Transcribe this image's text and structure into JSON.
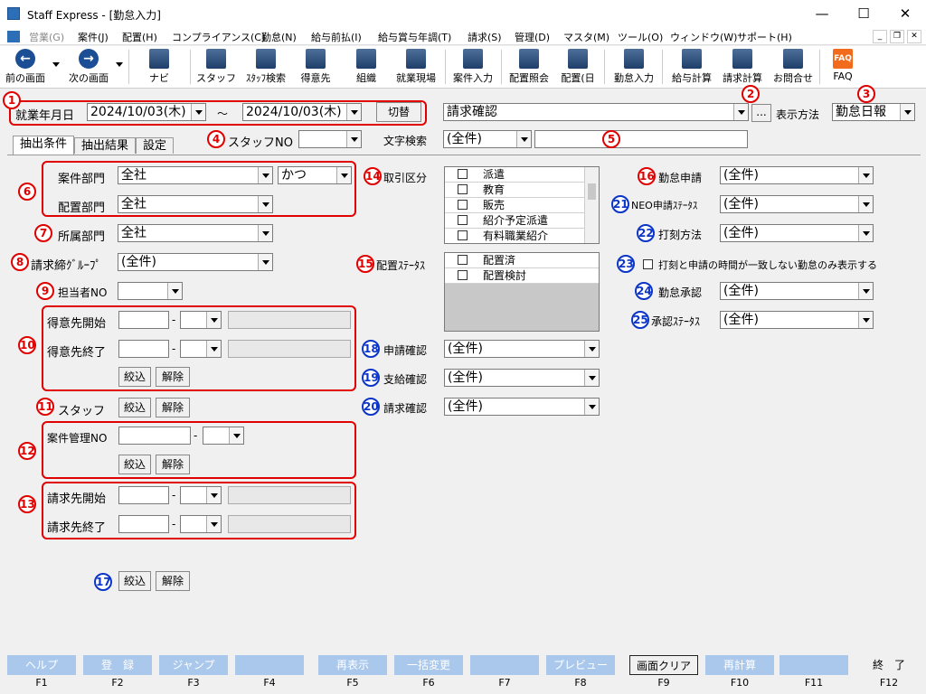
{
  "window": {
    "title": "Staff Express - [勤怠入力]",
    "minimize": "—",
    "maximize": "☐",
    "close": "✕"
  },
  "menu": [
    {
      "label": "営業(G)",
      "enabled": false
    },
    {
      "label": "案件(J)",
      "enabled": true
    },
    {
      "label": "配置(H)",
      "enabled": true
    },
    {
      "label": "コンプライアンス(C)",
      "enabled": true
    },
    {
      "label": "勤怠(N)",
      "enabled": true
    },
    {
      "label": "給与前払(I)",
      "enabled": true
    },
    {
      "label": "給与賞与年調(T)",
      "enabled": true
    },
    {
      "label": "請求(S)",
      "enabled": true
    },
    {
      "label": "管理(D)",
      "enabled": true
    },
    {
      "label": "マスタ(M)",
      "enabled": true
    },
    {
      "label": "ツール(O)",
      "enabled": true
    },
    {
      "label": "ウィンドウ(W)",
      "enabled": true
    },
    {
      "label": "サポート(H)",
      "enabled": true
    }
  ],
  "toolbar": {
    "back": "前の画面",
    "forward": "次の画面",
    "navi": "ナビ",
    "staff": "スタッフ",
    "staff_search": "ｽﾀｯﾌ検索",
    "client": "得意先",
    "org": "組織",
    "site": "就業現場",
    "job_entry": "案件入力",
    "assign_inquiry": "配置照会",
    "assign_day": "配置(日",
    "attendance_entry": "勤怠入力",
    "payroll_calc": "給与計算",
    "billing_calc": "請求計算",
    "contact": "お問合せ",
    "faq": "FAQ"
  },
  "header": {
    "date_label": "就業年月日",
    "date_from": "2024/10/03(木)",
    "tilde": "～",
    "date_to": "2024/10/03(木)",
    "switch_btn": "切替",
    "mode_select": "請求確認",
    "ellipsis": "...",
    "display_method_label": "表示方法",
    "display_method": "勤怠日報"
  },
  "tabs": [
    "抽出条件",
    "抽出結果",
    "設定"
  ],
  "row2": {
    "staff_no_label": "スタッフNO",
    "staff_no": "",
    "text_search_label": "文字検索",
    "text_search_select": "(全件)",
    "text_search_value": ""
  },
  "badges": {
    "b1": "1",
    "b2": "2",
    "b3": "3",
    "b4": "4",
    "b5": "5",
    "b6": "6",
    "b7": "7",
    "b8": "8",
    "b9": "9",
    "b10": "10",
    "b11": "11",
    "b12": "12",
    "b13": "13",
    "b14": "14",
    "b15": "15",
    "b16": "16",
    "b17": "17",
    "b18": "18",
    "b19": "19",
    "b20": "20",
    "b21": "21",
    "b22": "22",
    "b23": "23",
    "b24": "24",
    "b25": "25"
  },
  "left": {
    "job_dept_label": "案件部門",
    "job_dept": "全社",
    "job_dept_sub": "かつ",
    "assign_dept_label": "配置部門",
    "assign_dept": "全社",
    "belong_dept_label": "所属部門",
    "belong_dept": "全社",
    "billing_group_label": "請求締ｸﾞﾙｰﾌﾟ",
    "billing_group": "(全件)",
    "manager_no_label": "担当者NO",
    "manager_no": "",
    "client_start_label": "得意先開始",
    "client_end_label": "得意先終了",
    "dash": "-",
    "narrow": "絞込",
    "clear": "解除",
    "staff_label": "スタッフ",
    "job_mgmt_label": "案件管理NO",
    "bill_start_label": "請求先開始",
    "bill_end_label": "請求先終了"
  },
  "middle": {
    "trade_type_label": "取引区分",
    "trade_types": [
      "派遣",
      "教育",
      "販売",
      "紹介予定派遣",
      "有料職業紹介"
    ],
    "assign_status_label": "配置ｽﾃｰﾀｽ",
    "assign_statuses": [
      "配置済",
      "配置検討"
    ],
    "apply_confirm_label": "申請確認",
    "apply_confirm": "(全件)",
    "pay_confirm_label": "支給確認",
    "pay_confirm": "(全件)",
    "bill_confirm_label": "請求確認",
    "bill_confirm": "(全件)"
  },
  "right": {
    "att_apply_label": "勤怠申請",
    "att_apply": "(全件)",
    "neo_status_label": "NEO申請ｽﾃｰﾀｽ",
    "neo_status": "(全件)",
    "stamp_method_label": "打刻方法",
    "stamp_method": "(全件)",
    "mismatch_label": "打刻と申請の時間が一致しない勤怠のみ表示する",
    "att_approve_label": "勤怠承認",
    "att_approve": "(全件)",
    "approve_status_label": "承認ｽﾃｰﾀｽ",
    "approve_status": "(全件)"
  },
  "fkeys": [
    {
      "label": "ヘルプ",
      "key": "F1",
      "enabled": true
    },
    {
      "label": "登　録",
      "key": "F2",
      "enabled": false
    },
    {
      "label": "ジャンプ",
      "key": "F3",
      "enabled": false
    },
    {
      "label": "",
      "key": "F4",
      "enabled": false
    },
    {
      "label": "再表示",
      "key": "F5",
      "enabled": false
    },
    {
      "label": "一括変更",
      "key": "F6",
      "enabled": false
    },
    {
      "label": "",
      "key": "F7",
      "enabled": false
    },
    {
      "label": "プレビュー",
      "key": "F8",
      "enabled": false
    },
    {
      "label": "画面クリア",
      "key": "F9",
      "enabled": true
    },
    {
      "label": "再計算",
      "key": "F10",
      "enabled": false
    },
    {
      "label": "",
      "key": "F11",
      "enabled": false
    },
    {
      "label": "終　了",
      "key": "F12",
      "enabled": true
    }
  ],
  "colors": {
    "annotation_red": "#e00000",
    "annotation_blue": "#0a35c7",
    "fkey_disabled": "#a9c8ec"
  }
}
